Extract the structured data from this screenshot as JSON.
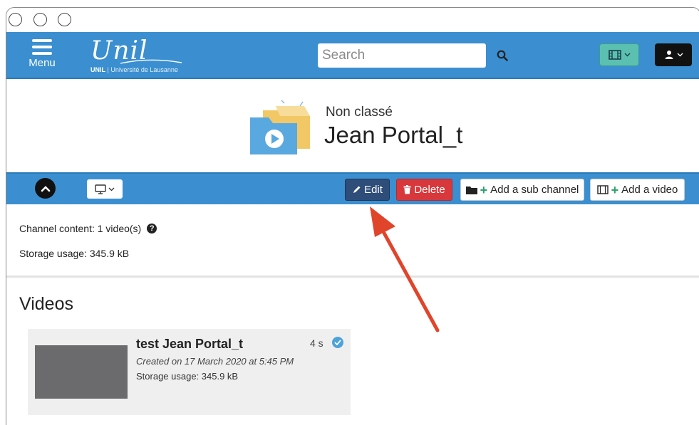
{
  "app": {
    "menu_label": "Menu",
    "logo": {
      "script": "Unil",
      "sub_bold": "UNIL",
      "sub_sep": "|",
      "sub_text": "Université de Lausanne"
    }
  },
  "search": {
    "placeholder": "Search",
    "value": ""
  },
  "header": {
    "category": "Non classé",
    "title": "Jean Portal_t"
  },
  "toolbar": {
    "edit_label": "Edit",
    "delete_label": "Delete",
    "add_sub_channel_label": "Add a sub channel",
    "add_video_label": "Add a video"
  },
  "info": {
    "channel_content": "Channel content: 1 video(s)",
    "help_glyph": "?",
    "storage_usage": "Storage usage: 345.9 kB"
  },
  "videos": {
    "heading": "Videos",
    "items": [
      {
        "title": "test Jean Portal_t",
        "duration": "4 s",
        "created": "Created on 17 March 2020 at 5:45 PM",
        "storage": "Storage usage: 345.9 kB"
      }
    ]
  },
  "colors": {
    "nav_blue": "#3b8fd0",
    "edit_button": "#2e4d78",
    "delete_button": "#d8383b",
    "video_menu_teal": "#5bc0b0",
    "annotation_arrow": "#e0452b",
    "thumbnail_gray": "#6b6b6d"
  },
  "icons": {
    "menu": "hamburger-icon",
    "search": "search-icon",
    "video_menu": "film-icon",
    "user_menu": "user-icon",
    "collapse": "chevron-up-icon",
    "display": "monitor-icon",
    "edit": "pencil-icon",
    "delete": "trash-icon",
    "add_sub_channel": "folder-plus-icon",
    "add_video": "film-plus-icon",
    "status": "check-circle-icon"
  }
}
